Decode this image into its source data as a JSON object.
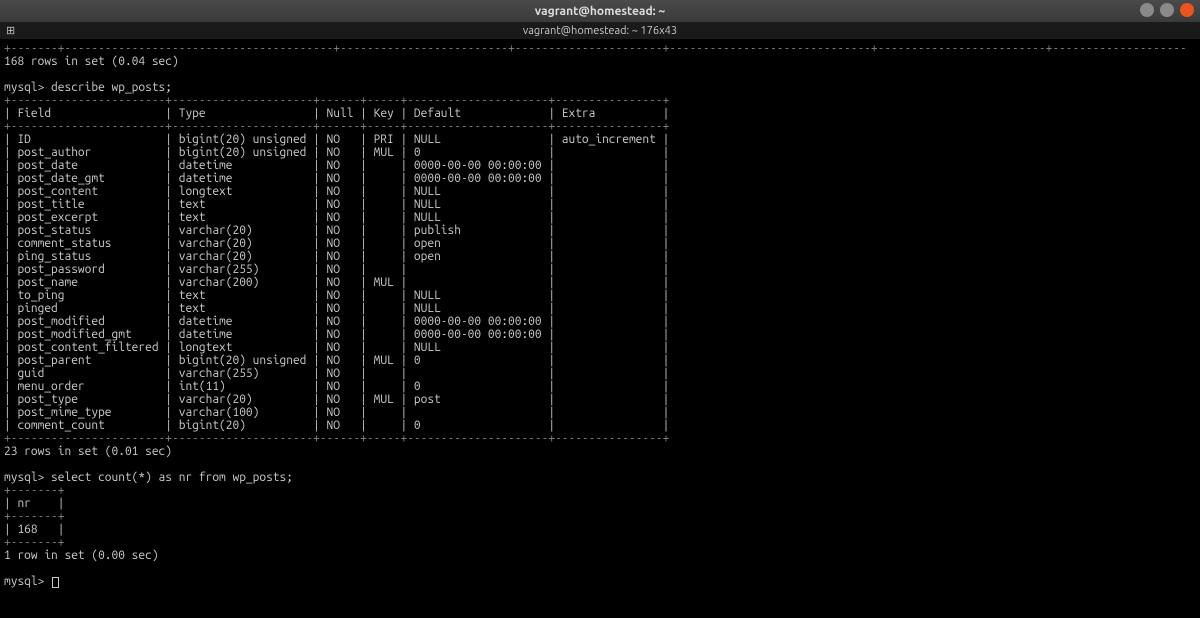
{
  "window": {
    "title": "vagrant@homestead: ~",
    "dimbar": "vagrant@homestead: ~ 176x43"
  },
  "pre_rows_msg": "168 rows in set (0.04 sec)",
  "cmd_describe": "mysql> describe wp_posts;",
  "describe_headers": [
    "Field",
    "Type",
    "Null",
    "Key",
    "Default",
    "Extra"
  ],
  "describe_rows": [
    [
      "ID",
      "bigint(20) unsigned",
      "NO",
      "PRI",
      "NULL",
      "auto_increment"
    ],
    [
      "post_author",
      "bigint(20) unsigned",
      "NO",
      "MUL",
      "0",
      ""
    ],
    [
      "post_date",
      "datetime",
      "NO",
      "",
      "0000-00-00 00:00:00",
      ""
    ],
    [
      "post_date_gmt",
      "datetime",
      "NO",
      "",
      "0000-00-00 00:00:00",
      ""
    ],
    [
      "post_content",
      "longtext",
      "NO",
      "",
      "NULL",
      ""
    ],
    [
      "post_title",
      "text",
      "NO",
      "",
      "NULL",
      ""
    ],
    [
      "post_excerpt",
      "text",
      "NO",
      "",
      "NULL",
      ""
    ],
    [
      "post_status",
      "varchar(20)",
      "NO",
      "",
      "publish",
      ""
    ],
    [
      "comment_status",
      "varchar(20)",
      "NO",
      "",
      "open",
      ""
    ],
    [
      "ping_status",
      "varchar(20)",
      "NO",
      "",
      "open",
      ""
    ],
    [
      "post_password",
      "varchar(255)",
      "NO",
      "",
      "",
      ""
    ],
    [
      "post_name",
      "varchar(200)",
      "NO",
      "MUL",
      "",
      ""
    ],
    [
      "to_ping",
      "text",
      "NO",
      "",
      "NULL",
      ""
    ],
    [
      "pinged",
      "text",
      "NO",
      "",
      "NULL",
      ""
    ],
    [
      "post_modified",
      "datetime",
      "NO",
      "",
      "0000-00-00 00:00:00",
      ""
    ],
    [
      "post_modified_gmt",
      "datetime",
      "NO",
      "",
      "0000-00-00 00:00:00",
      ""
    ],
    [
      "post_content_filtered",
      "longtext",
      "NO",
      "",
      "NULL",
      ""
    ],
    [
      "post_parent",
      "bigint(20) unsigned",
      "NO",
      "MUL",
      "0",
      ""
    ],
    [
      "guid",
      "varchar(255)",
      "NO",
      "",
      "",
      ""
    ],
    [
      "menu_order",
      "int(11)",
      "NO",
      "",
      "0",
      ""
    ],
    [
      "post_type",
      "varchar(20)",
      "NO",
      "MUL",
      "post",
      ""
    ],
    [
      "post_mime_type",
      "varchar(100)",
      "NO",
      "",
      "",
      ""
    ],
    [
      "comment_count",
      "bigint(20)",
      "NO",
      "",
      "0",
      ""
    ]
  ],
  "describe_summary": "23 rows in set (0.01 sec)",
  "cmd_count": "mysql> select count(*) as nr from wp_posts;",
  "count_header": "nr",
  "count_value": "168",
  "count_summary": "1 row in set (0.00 sec)",
  "prompt": "mysql> "
}
